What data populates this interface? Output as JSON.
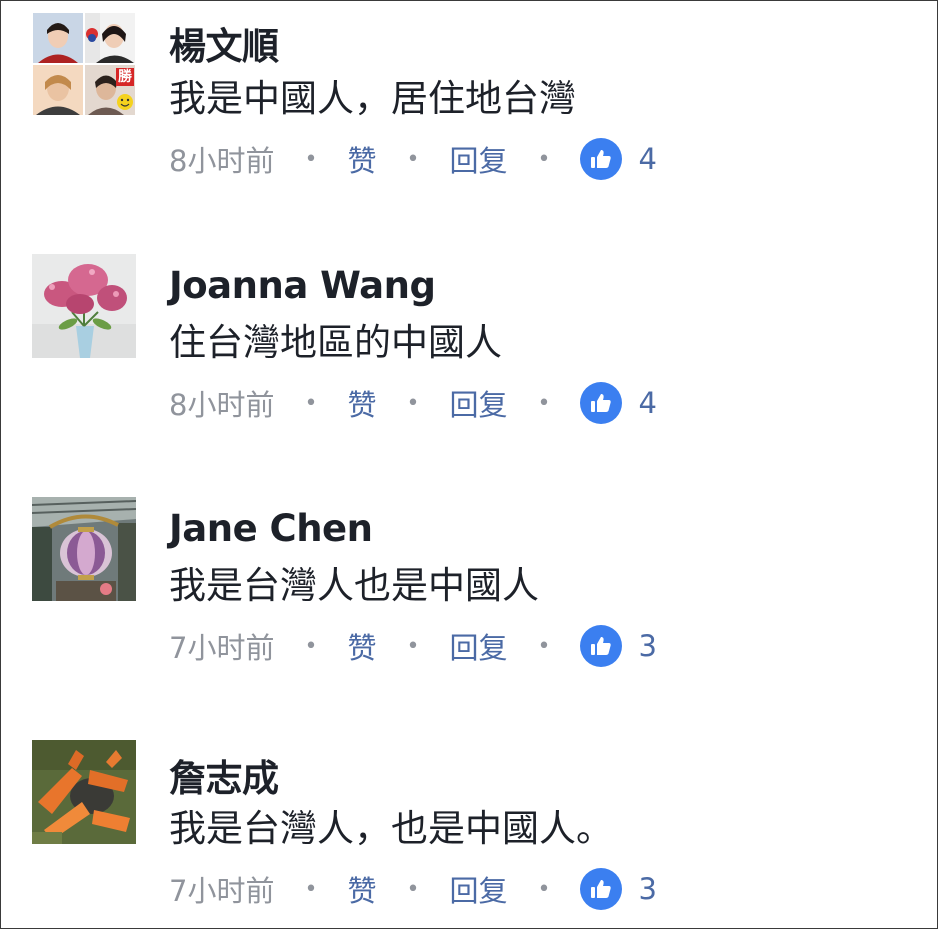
{
  "comments": [
    {
      "author": "楊文順",
      "text": "我是中國人，居住地台灣",
      "time": "8小时前",
      "like_label": "赞",
      "reply_label": "回复",
      "like_count": "4",
      "avatar_badge": "勝",
      "avatar_icon": "collage-avatar"
    },
    {
      "author": "Joanna Wang",
      "text": "住台灣地區的中國人",
      "time": "8小时前",
      "like_label": "赞",
      "reply_label": "回复",
      "like_count": "4",
      "avatar_icon": "flowers-avatar"
    },
    {
      "author": "Jane Chen",
      "text": "我是台灣人也是中國人",
      "time": "7小时前",
      "like_label": "赞",
      "reply_label": "回复",
      "like_count": "3",
      "avatar_icon": "lantern-avatar"
    },
    {
      "author": "詹志成",
      "text": "我是台灣人，也是中國人。",
      "time": "7小时前",
      "like_label": "赞",
      "reply_label": "回复",
      "like_count": "3",
      "avatar_icon": "gloves-avatar"
    }
  ],
  "colors": {
    "like_badge": "#3b7ff0",
    "link": "#4b6aa5",
    "timestamp": "#90949c",
    "text": "#1d2129"
  }
}
